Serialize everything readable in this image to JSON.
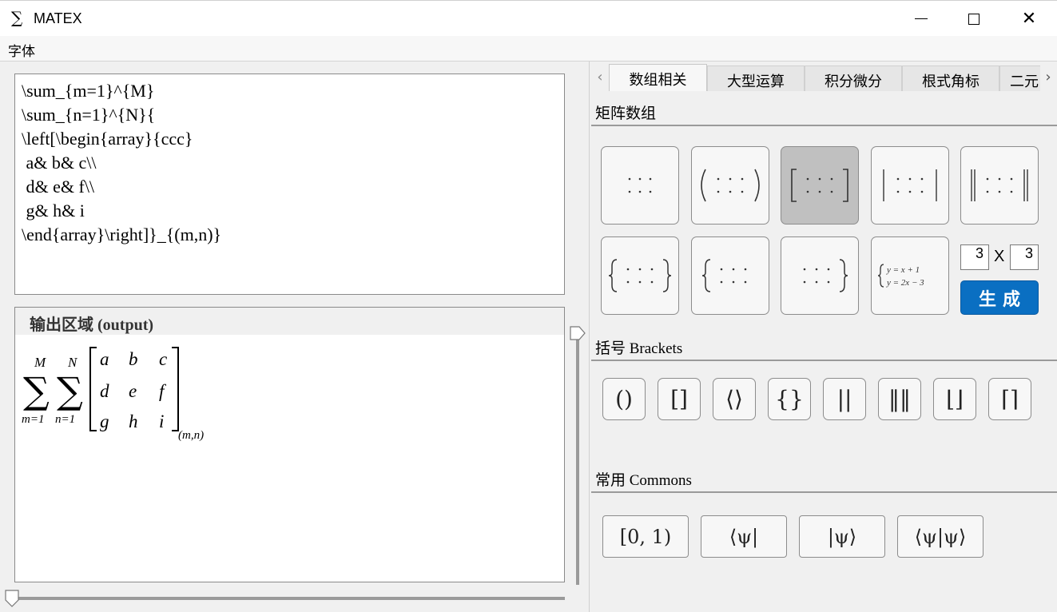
{
  "window": {
    "icon": "∑",
    "title": "MATEX",
    "icon_name": "sigma-icon",
    "controls": {
      "minimize": "minimize-icon",
      "maximize": "maximize-icon",
      "close": "✕"
    }
  },
  "menu": {
    "items": [
      "字体"
    ]
  },
  "editor": {
    "lines": [
      "\\sum_{m=1}^{M}",
      "\\sum_{n=1}^{N}{",
      "\\left[\\begin{array}{ccc}",
      " a& b& c\\\\",
      " d& e& f\\\\",
      " g& h& i",
      "\\end{array}\\right]}_{(m,n)}"
    ]
  },
  "output": {
    "title": "输出区域 (output)",
    "formula": {
      "sum1_upper": "M",
      "sum1_lower": "m=1",
      "sum2_upper": "N",
      "sum2_lower": "n=1",
      "sigma": "∑",
      "matrix": [
        [
          "a",
          "b",
          "c"
        ],
        [
          "d",
          "e",
          "f"
        ],
        [
          "g",
          "h",
          "i"
        ]
      ],
      "subscript": "(m,n)"
    }
  },
  "tabs": {
    "items": [
      "数组相关",
      "大型运算",
      "积分微分",
      "根式角标",
      "二元"
    ],
    "active": 0,
    "scroll_left": "‹",
    "scroll_right": "›"
  },
  "sections": {
    "matrix": "矩阵数组",
    "brackets": "括号 Brackets",
    "commons": "常用 Commons"
  },
  "matrix_buttons": {
    "selected_index": 2,
    "system_line1": "y = x + 1",
    "system_line2": "y = 2x − 3"
  },
  "dims": {
    "rows": "3",
    "cols": "3",
    "x": "X"
  },
  "generate_label": "生成",
  "brackets": [
    "()",
    "[]",
    "⟨⟩",
    "{}",
    "||",
    "‖‖",
    "⌊⌋",
    "⌈⌉"
  ],
  "commons": [
    "[0, 1)",
    "⟨ψ|",
    "|ψ⟩",
    "⟨ψ|ψ⟩"
  ],
  "colors": {
    "accent": "#0a6fc2",
    "selected": "#c0c0c0"
  }
}
